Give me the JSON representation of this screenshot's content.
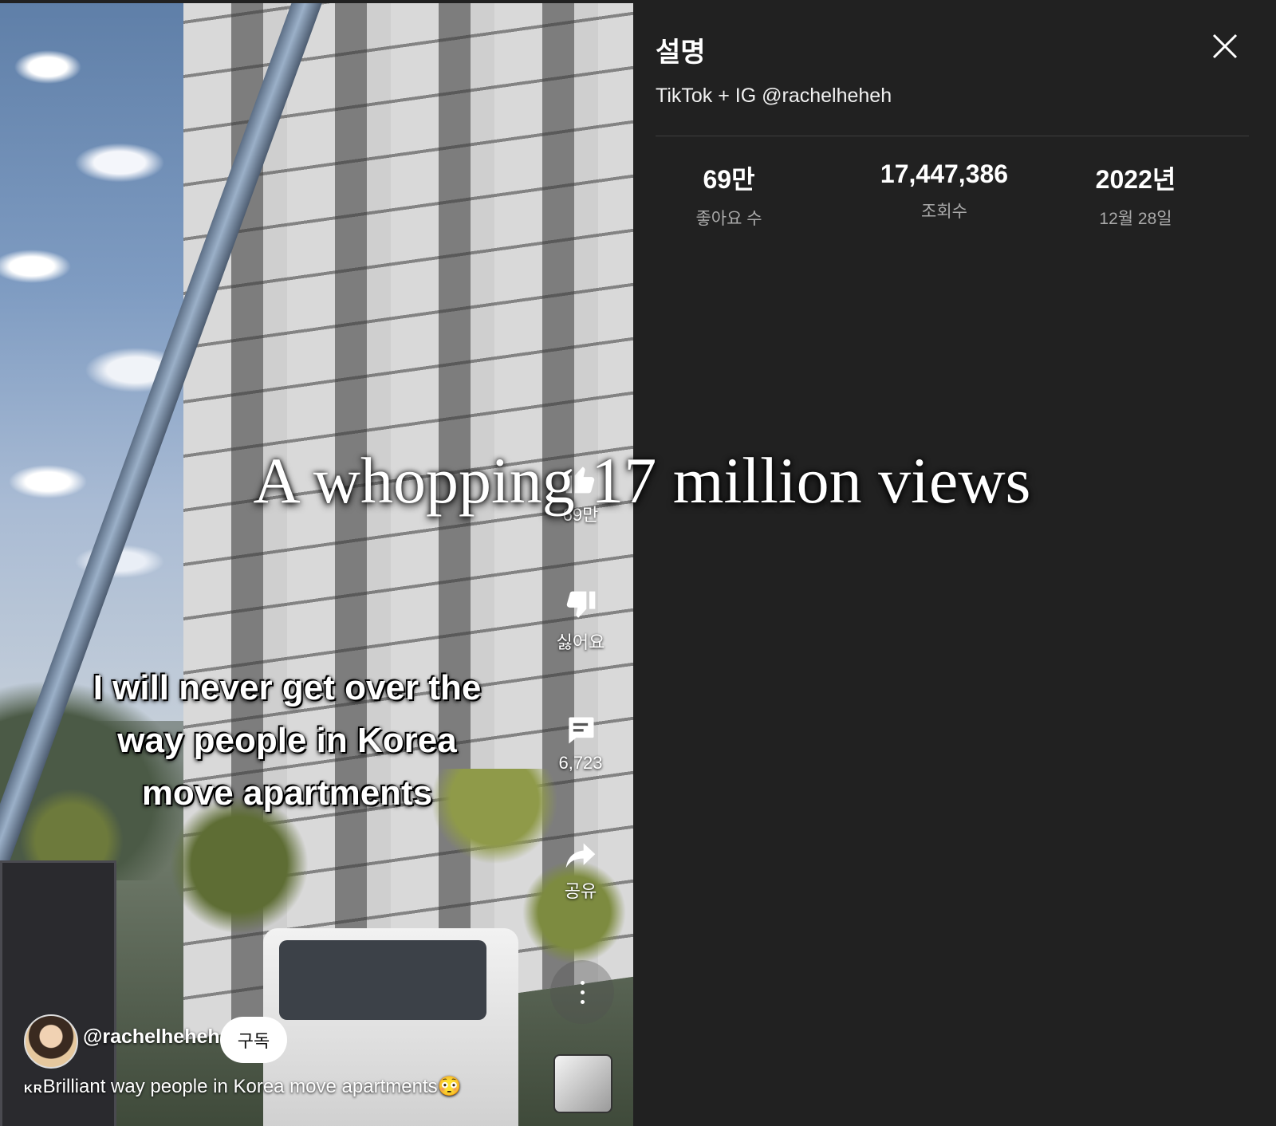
{
  "overlay": {
    "headline": "A whopping 17 million views"
  },
  "video": {
    "caption_lines": [
      "I will never get over the",
      "way people in Korea",
      "move apartments"
    ],
    "actions": {
      "like_count": "69만",
      "dislike_label": "싫어요",
      "comment_count": "6,723",
      "share_label": "공유"
    },
    "channel": "@rachelheheh",
    "subscribe_label": "구독",
    "title_prefix": "KR",
    "title": "Brilliant way people in Korea move apartments",
    "title_emoji": "😳"
  },
  "panel": {
    "title": "설명",
    "description": "TikTok + IG  @rachelheheh",
    "stats": [
      {
        "value": "69만",
        "label": "좋아요 수"
      },
      {
        "value": "17,447,386",
        "label": "조회수"
      },
      {
        "value": "2022년",
        "label": "12월 28일"
      }
    ]
  }
}
